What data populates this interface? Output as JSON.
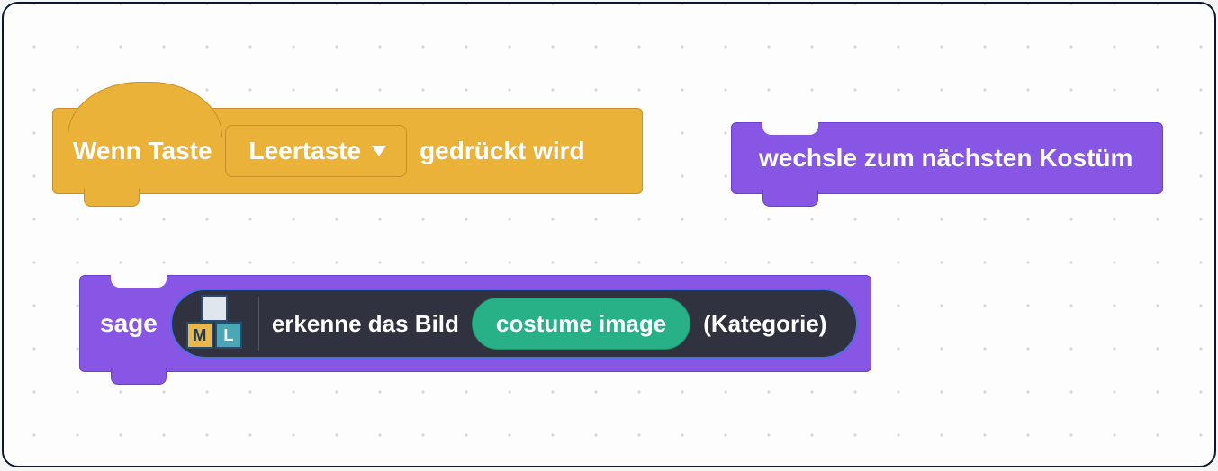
{
  "event_block": {
    "prefix": "Wenn Taste",
    "dropdown_value": "Leertaste",
    "suffix": "gedrückt wird"
  },
  "costume_block": {
    "label": "wechsle zum nächsten Kostüm"
  },
  "say_block": {
    "label": "sage",
    "ml_reporter": {
      "icon_letters": {
        "m": "M",
        "l": "L"
      },
      "prefix": "erkenne das Bild",
      "input_value": "costume image",
      "suffix": "(Kategorie)"
    }
  }
}
